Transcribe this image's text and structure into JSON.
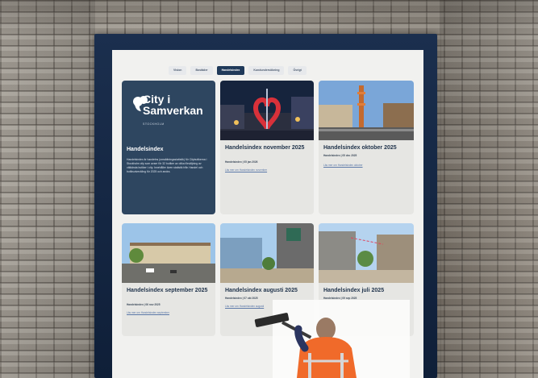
{
  "nav": {
    "tabs": [
      "Vision",
      "Bostäder",
      "Handelsindex",
      "Kundundersökning",
      "Övrigt"
    ],
    "active_index": 2
  },
  "brand": {
    "name_line1": "City i",
    "name_line2": "Samverkan",
    "sub": "STOCKHOLM",
    "title": "Handelsindex",
    "description": "Handelsindex är handelns (omsättningsstatistik) för Citybutikerna i Stockholm city som avser för 32 butiker av olika försäljning av välkända butiker i city. Innehåller även statistik från Handel och butiksutveckling för 2025 och andra."
  },
  "cards": [
    {
      "title": "Handelsindex november 2025",
      "meta": "Handelsindex | 05 jan 2026",
      "link": "Läs mer om Handelsindex november"
    },
    {
      "title": "Handelsindex oktober 2025",
      "meta": "Handelsindex | 05 dec 2025",
      "link": "Läs mer om Handelsindex oktober"
    },
    {
      "title": "Handelsindex september 2025",
      "meta": "Handelsindex | 06 nov 2025",
      "link": "Läs mer om Handelsindex september"
    },
    {
      "title": "Handelsindex augusti 2025",
      "meta": "Handelsindex | 07 okt 2025",
      "link": "Läs mer om Handelsindex augusti"
    },
    {
      "title": "Handelsindex juli 2025",
      "meta": "Handelsindex | 09 sep 2025",
      "link": "Läs mer om Handelsindex juli"
    }
  ],
  "colors": {
    "frame": "#1b2f4e",
    "brand_card": "#2e4660",
    "nav_active": "#203a5a",
    "worker_vest": "#f06a2a"
  }
}
